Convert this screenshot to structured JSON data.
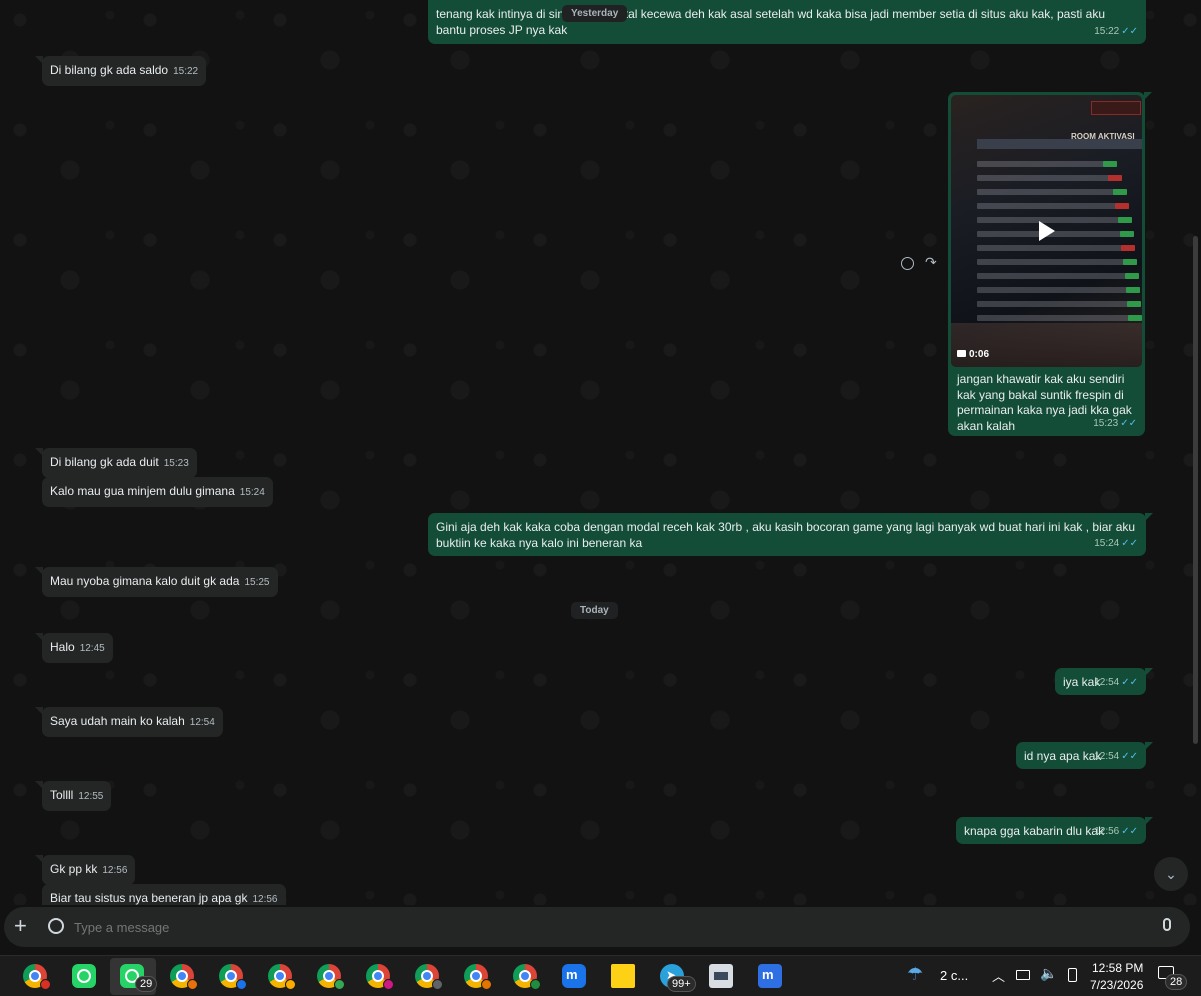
{
  "messages": {
    "m1": {
      "text": "tenang kak intinya di sini",
      "text2": "tal kecewa deh kak asal setelah wd kaka bisa jadi member setia di situs aku kak, pasti aku bantu proses JP nya kak",
      "time": "15:22"
    },
    "m2": {
      "text": "Di bilang gk ada saldo",
      "time": "15:22"
    },
    "m3": {
      "caption": "jangan khawatir kak aku sendiri kak yang bakal suntik frespin di permainan kaka nya jadi kka gak akan kalah",
      "duration": "0:06",
      "time": "15:23",
      "video_title": "ROOM AKTIVASI"
    },
    "m4": {
      "text": "Di bilang gk ada duit",
      "time": "15:23"
    },
    "m5": {
      "text": "Kalo mau gua minjem dulu gimana",
      "time": "15:24"
    },
    "m6": {
      "text": "Gini aja deh kak kaka coba dengan modal receh kak 30rb , aku kasih bocoran game yang lagi banyak wd buat hari ini kak , biar aku buktiin ke kaka nya kalo ini beneran ka",
      "time": "15:24"
    },
    "m7": {
      "text": "Mau nyoba gimana kalo duit gk ada",
      "time": "15:25"
    },
    "m8": {
      "text": "Halo",
      "time": "12:45"
    },
    "m9": {
      "text": "iya kak",
      "time": "12:54"
    },
    "m10": {
      "text": "Saya udah main ko kalah",
      "time": "12:54"
    },
    "m11": {
      "text": "id nya apa kak",
      "time": "12:54"
    },
    "m12": {
      "text": "Tollll",
      "time": "12:55"
    },
    "m13": {
      "text": "knapa gga kabarin dlu kak",
      "time": "12:56"
    },
    "m14": {
      "text": "Gk pp kk",
      "time": "12:56"
    },
    "m15": {
      "text": "Biar tau sistus nya beneran jp apa gk",
      "time": "12:56"
    }
  },
  "date_chips": {
    "yesterday": "Yesterday",
    "today": "Today"
  },
  "composer": {
    "placeholder": "Type a message"
  },
  "taskbar": {
    "whatsapp_count": "29",
    "telegram_count": "99+",
    "weather": "2 c...",
    "clock_time": "12:58 PM",
    "clock_date": "7/23/2026",
    "notifications": "28"
  },
  "colors": {
    "outgoing": "#144d37",
    "incoming": "#242626",
    "read_ticks": "#53bdeb"
  }
}
